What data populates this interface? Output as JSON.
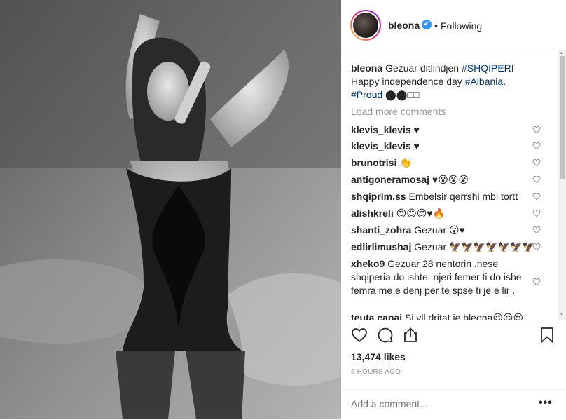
{
  "header": {
    "username": "bleona",
    "verified_icon": "✔",
    "separator": "•",
    "follow_status": "Following"
  },
  "caption": {
    "user": "bleona",
    "text_1": "Gezuar ditlindjen",
    "tag_1": "#SHQIPERI",
    "text_2": "Happy independence day",
    "tag_2": "#Albania",
    "text_3": ".",
    "tag_3": "#Proud",
    "emoji": "⬤⬤□□"
  },
  "load_more": "Load more comments",
  "comments": [
    {
      "user": "klevis_klevis",
      "text": "♥"
    },
    {
      "user": "klevis_klevis",
      "text": "♥"
    },
    {
      "user": "brunotrisi",
      "text": "👏"
    },
    {
      "user": "antigoneramosaj",
      "text": "♥😮😮😮"
    },
    {
      "user": "shqiprim.ss",
      "text": "Embelsir qerrshi mbi tortt"
    },
    {
      "user": "alishkreli",
      "text": "😍😍😍♥🔥"
    },
    {
      "user": "shanti_zohra",
      "text": "Gezuar 😮♥"
    },
    {
      "user": "edlirlimushaj",
      "text": "Gezuar 🦅🦅🦅🦅🦅🦅🦅"
    },
    {
      "user": "xheko9",
      "text": "Gezuar 28 nentorin .nese shqiperia do ishte .njeri femer ti do ishe femra me e denj per te spse ti je e lir ."
    },
    {
      "user": "teuta.capai",
      "text": "Si yll dritat je bleona😍😍😍"
    }
  ],
  "likes": "13,474 likes",
  "timestamp": "6 HOURS AGO",
  "comment_input": {
    "placeholder": "Add a comment..."
  },
  "more_options": "•••",
  "icons": {
    "like": "heart-icon",
    "comment": "comment-icon",
    "share": "share-icon",
    "save": "bookmark-icon"
  }
}
